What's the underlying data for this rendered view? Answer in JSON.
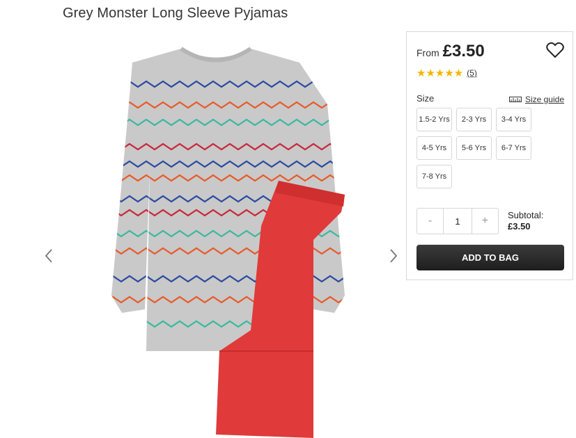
{
  "product": {
    "title": "Grey Monster Long Sleeve Pyjamas"
  },
  "gallery": {
    "prev_icon": "chevron-left-icon",
    "next_icon": "chevron-right-icon"
  },
  "purchase": {
    "from_label": "From",
    "price": "£3.50",
    "rating": {
      "stars": "★★★★★",
      "value": 5,
      "count": "(5)"
    },
    "size_label": "Size",
    "size_guide_label": "Size guide",
    "sizes": [
      "1.5-2 Yrs",
      "2-3 Yrs",
      "3-4 Yrs",
      "4-5 Yrs",
      "5-6 Yrs",
      "6-7 Yrs",
      "7-8 Yrs"
    ],
    "quantity": {
      "minus": "-",
      "value": "1",
      "plus": "+"
    },
    "subtotal_label": "Subtotal:",
    "subtotal_value": "£3.50",
    "add_to_bag": "ADD TO BAG"
  },
  "colors": {
    "star": "#f6b400",
    "button": "#2b2b2b",
    "trousers": "#e03a3a",
    "top": "#c9c9c9"
  }
}
